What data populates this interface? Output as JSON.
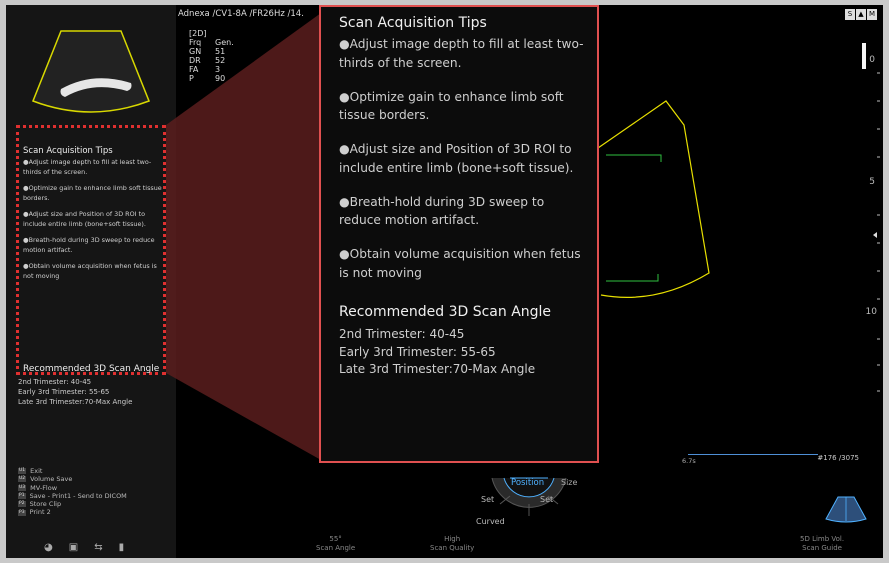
{
  "header": {
    "title": "Adnexa /CV1-8A /FR26Hz /14."
  },
  "params": {
    "mode": "[2D]",
    "rows": [
      {
        "k": "Frq",
        "v": "Gen."
      },
      {
        "k": "GN",
        "v": "51"
      },
      {
        "k": "DR",
        "v": "52"
      },
      {
        "k": "FA",
        "v": "3"
      },
      {
        "k": "P",
        "v": "90"
      }
    ]
  },
  "tips_small": {
    "title": "Scan Acquisition Tips",
    "items": [
      "●Adjust image depth to fill at least two-thirds of the screen.",
      "●Optimize gain to enhance limb soft tissue borders.",
      "●Adjust size and Position of 3D ROI to include entire limb (bone+soft tissue).",
      "●Breath-hold during 3D sweep to reduce motion artifact.",
      "●Obtain volume acquisition when fetus is not moving"
    ],
    "angle_title": "Recommended 3D Scan Angle"
  },
  "trimesters": [
    "2nd Trimester: 40-45",
    "Early 3rd Trimester: 55-65",
    "Late 3rd Trimester:70-Max Angle"
  ],
  "popup": {
    "title": "Scan Acquisition Tips",
    "items": [
      "●Adjust image depth to fill at least two-thirds of the screen.",
      "●Optimize gain to enhance limb soft tissue borders.",
      "●Adjust size and Position of 3D ROI to include entire limb (bone+soft tissue).",
      "●Breath-hold during 3D sweep to reduce motion artifact.",
      "●Obtain volume acquisition when fetus is not moving"
    ],
    "angle_title": "Recommended 3D Scan Angle",
    "angles": [
      "2nd Trimester: 40-45",
      "Early 3rd Trimester: 55-65",
      "Late 3rd Trimester:70-Max Angle"
    ]
  },
  "shortcuts": [
    {
      "key": "U1",
      "label": "Exit"
    },
    {
      "key": "U2",
      "label": "Volume Save"
    },
    {
      "key": "U3",
      "label": "MV-Flow"
    },
    {
      "key": "P1",
      "label": "Save - Print1 - Send to DICOM"
    },
    {
      "key": "P2",
      "label": "Store Clip"
    },
    {
      "key": "P3",
      "label": "Print 2"
    }
  ],
  "scale": {
    "top": "0",
    "mid": "5",
    "bottom": "10"
  },
  "depth": {
    "value": "6.7s",
    "frames": "#176 /3075"
  },
  "dial": {
    "active": "Position",
    "size": "Size",
    "set_left": "Set",
    "set_right": "Set",
    "curved": "Curved"
  },
  "bottom_bar": {
    "scan_angle_value": "55°",
    "scan_angle_label": "Scan Angle",
    "scan_quality_value": "High",
    "scan_quality_label": "Scan Quality",
    "guide_value": "5D Limb Vol.",
    "guide_label": "Scan Guide"
  },
  "colors": {
    "accent": "#4fb1ff",
    "highlight_border": "#e03030",
    "roi": "#e8e000",
    "roi_green": "#2fbf3f"
  }
}
